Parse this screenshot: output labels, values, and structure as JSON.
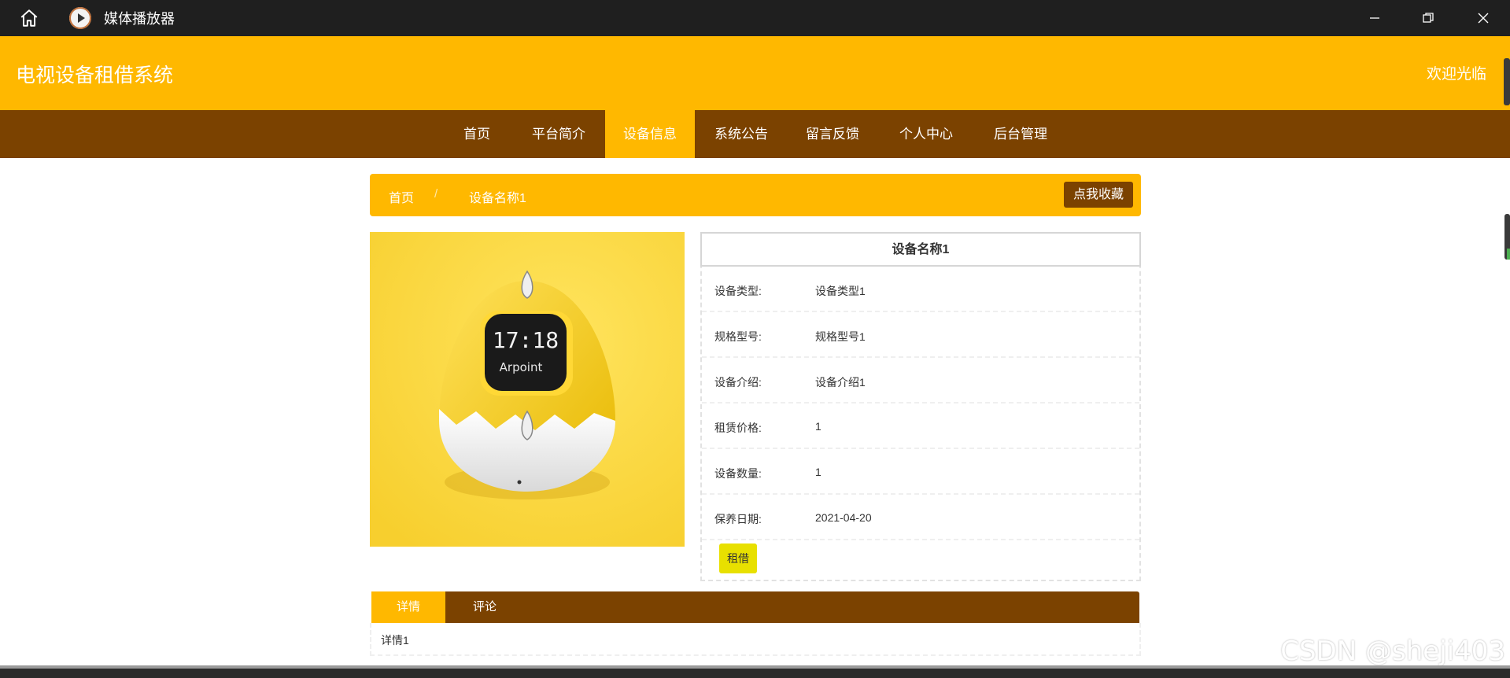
{
  "window": {
    "app_title": "媒体播放器"
  },
  "header": {
    "site_title": "电视设备租借系统",
    "welcome": "欢迎光临"
  },
  "nav": {
    "items": [
      {
        "label": "首页",
        "active": false
      },
      {
        "label": "平台简介",
        "active": false
      },
      {
        "label": "设备信息",
        "active": true
      },
      {
        "label": "系统公告",
        "active": false
      },
      {
        "label": "留言反馈",
        "active": false
      },
      {
        "label": "个人中心",
        "active": false
      },
      {
        "label": "后台管理",
        "active": false
      }
    ]
  },
  "breadcrumb": {
    "home": "首页",
    "separator": "/",
    "current": "设备名称1",
    "favorite_button": "点我收藏"
  },
  "product": {
    "image": {
      "clock_time": "17:18",
      "brand": "Arpoint"
    },
    "name": "设备名称1",
    "fields": [
      {
        "label": "设备类型:",
        "value": "设备类型1"
      },
      {
        "label": "规格型号:",
        "value": "规格型号1"
      },
      {
        "label": "设备介绍:",
        "value": "设备介绍1"
      },
      {
        "label": "租赁价格:",
        "value": "1"
      },
      {
        "label": "设备数量:",
        "value": "1"
      },
      {
        "label": "保养日期:",
        "value": "2021-04-20"
      }
    ],
    "rent_button": "租借"
  },
  "tabs": {
    "items": [
      {
        "label": "详情",
        "active": true
      },
      {
        "label": "评论",
        "active": false
      }
    ],
    "content": "详情1"
  },
  "watermark": "CSDN @sheji403",
  "colors": {
    "header_yellow": "#ffb800",
    "nav_brown": "#7b4200",
    "rent_button": "#e8e000"
  }
}
